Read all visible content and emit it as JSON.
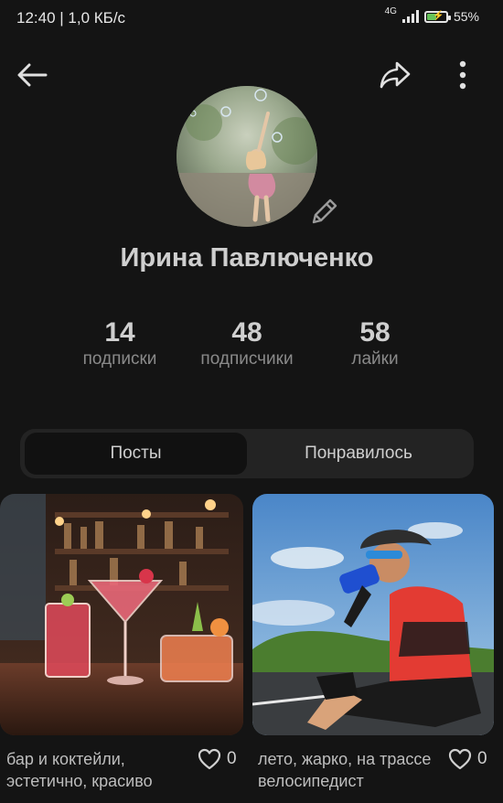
{
  "status_bar": {
    "time_speed": "12:40 | 1,0 КБ/с",
    "network": "4G",
    "battery_pct": "55%",
    "battery_level": 0.55,
    "battery_color": "#66c35a"
  },
  "header": {
    "back_icon": "arrow-left-icon",
    "share_icon": "share-arrow-icon",
    "more_icon": "more-vertical-icon"
  },
  "profile": {
    "name": "Ирина Павлюченко",
    "edit_icon": "pencil-icon",
    "stats": [
      {
        "value": "14",
        "label": "подписки"
      },
      {
        "value": "48",
        "label": "подписчики"
      },
      {
        "value": "58",
        "label": "лайки"
      }
    ]
  },
  "tabs": [
    {
      "label": "Посты",
      "active": true
    },
    {
      "label": "Понравилось",
      "active": false
    }
  ],
  "posts": [
    {
      "caption": "бар и коктейли, эстетично, красиво",
      "likes": "0",
      "like_icon": "heart-outline-icon"
    },
    {
      "caption": "лето, жарко, на трассе велосипедист",
      "likes": "0",
      "like_icon": "heart-outline-icon"
    }
  ]
}
